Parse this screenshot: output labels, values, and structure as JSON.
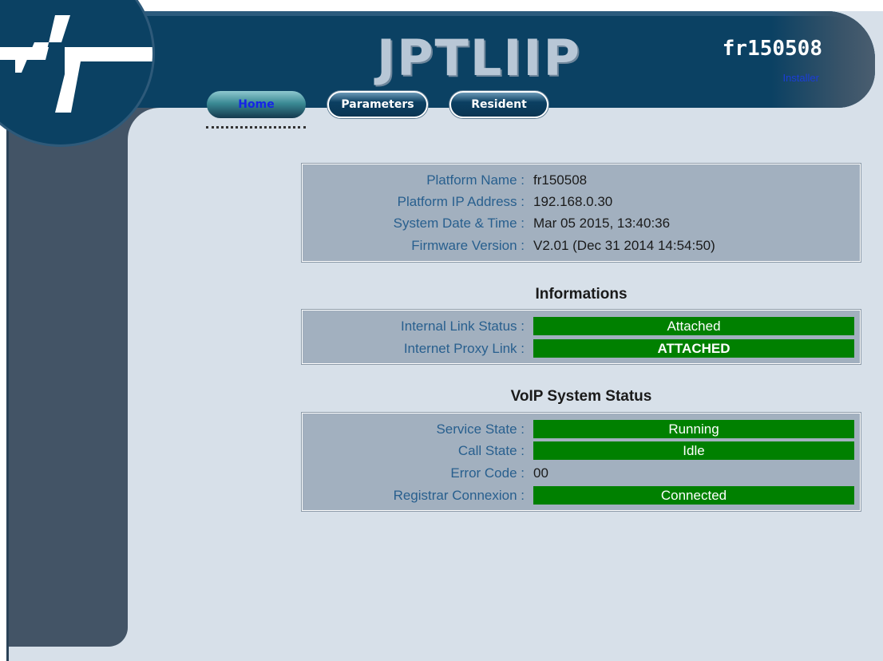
{
  "header": {
    "title": "JPTLIIP",
    "platform_name": "fr150508",
    "role_link": "Installer"
  },
  "nav": {
    "home": "Home",
    "parameters": "Parameters",
    "resident": "Resident"
  },
  "platform_info": [
    {
      "label": "Platform Name :",
      "value": "fr150508"
    },
    {
      "label": "Platform IP Address :",
      "value": "192.168.0.30"
    },
    {
      "label": "System Date & Time :",
      "value": "Mar 05 2015, 13:40:36"
    },
    {
      "label": "Firmware Version :",
      "value": "V2.01 (Dec 31 2014 14:54:50)"
    }
  ],
  "informations": {
    "title": "Informations",
    "rows": [
      {
        "label": "Internal Link Status :",
        "value": "Attached"
      },
      {
        "label": "Internet Proxy Link :",
        "value": "ATTACHED"
      }
    ]
  },
  "voip": {
    "title": "VoIP System Status",
    "rows": [
      {
        "label": "Service State :",
        "value": "Running"
      },
      {
        "label": "Call State :",
        "value": "Idle"
      },
      {
        "label": "Error Code :",
        "value": "00"
      },
      {
        "label": "Registrar Connexion :",
        "value": "Connected"
      }
    ]
  },
  "colors": {
    "status_green": "#008000",
    "header_navy": "#0b4163",
    "sidebar": "#435466",
    "label_blue": "#285f8e",
    "background": "#d7e0e9"
  }
}
